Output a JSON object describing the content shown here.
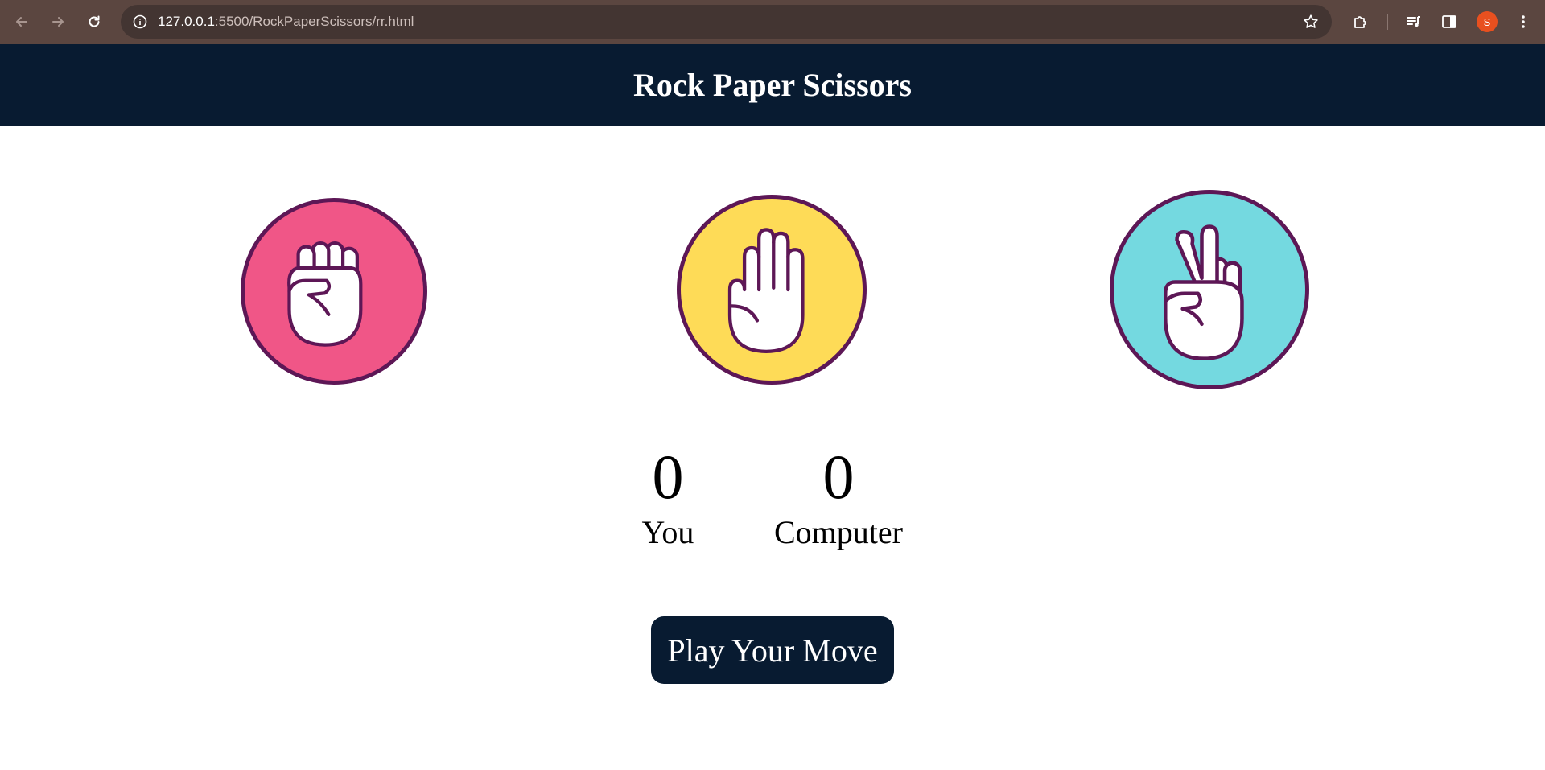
{
  "browser": {
    "url_host": "127.0.0.1",
    "url_rest": ":5500/RockPaperScissors/rr.html",
    "profile_initial": "S"
  },
  "page": {
    "title": "Rock Paper Scissors"
  },
  "choices": [
    {
      "id": "rock",
      "color": "#f05687"
    },
    {
      "id": "paper",
      "color": "#fedb57"
    },
    {
      "id": "scissors",
      "color": "#74d9e0"
    }
  ],
  "scoreboard": {
    "user_score": "0",
    "user_label": "You",
    "computer_score": "0",
    "computer_label": "Computer"
  },
  "play_button": {
    "label": "Play Your Move"
  },
  "colors": {
    "header_bg": "#081b31",
    "outline": "#5d1756"
  }
}
